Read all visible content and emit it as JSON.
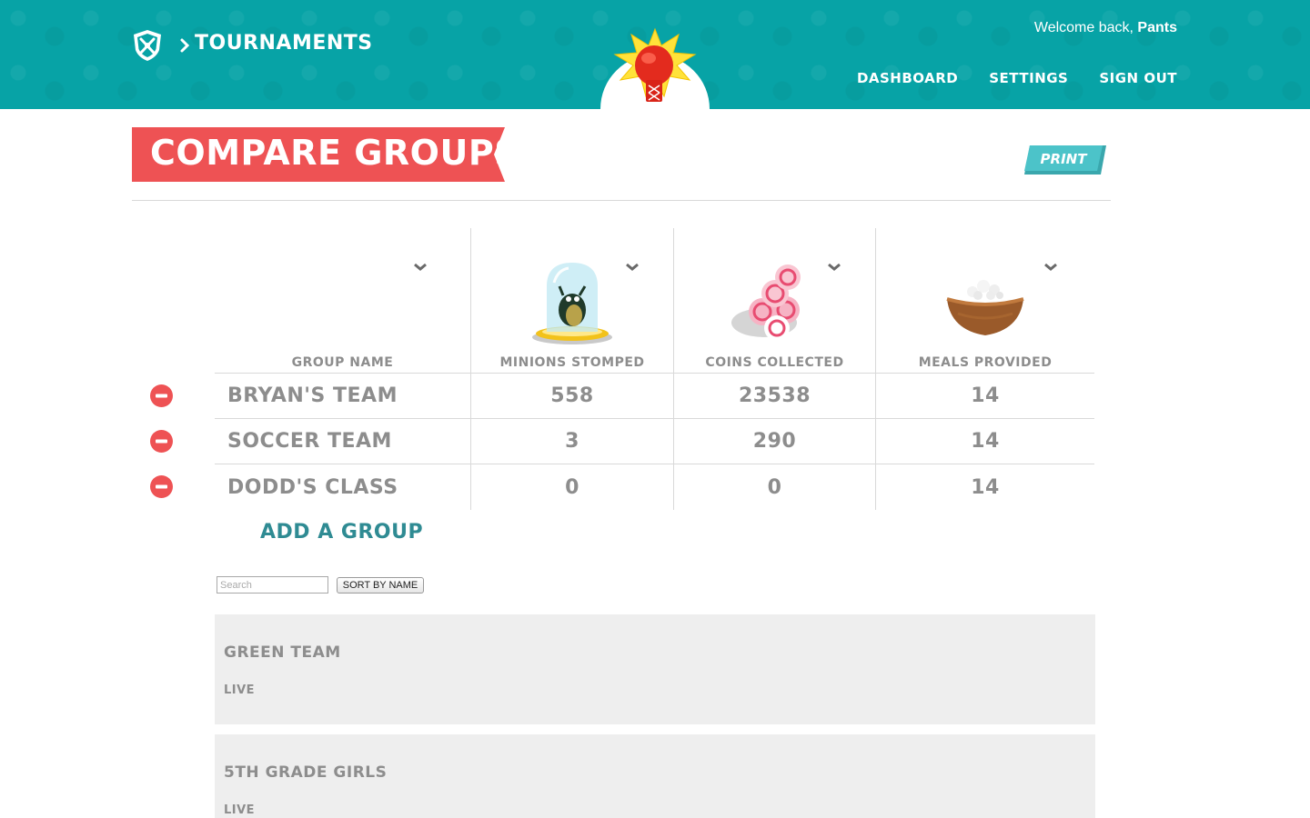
{
  "header": {
    "breadcrumb": "TOURNAMENTS",
    "welcome_prefix": "Welcome back,",
    "user_name": "Pants",
    "nav": [
      "DASHBOARD",
      "SETTINGS",
      "SIGN OUT"
    ]
  },
  "page": {
    "title": "COMPARE GROUPS",
    "print_label": "PRINT"
  },
  "compare": {
    "columns": [
      "GROUP NAME",
      "MINIONS STOMPED",
      "COINS COLLECTED",
      "MEALS PROVIDED"
    ],
    "column_icons": [
      "",
      "minion-in-glass-dome-icon",
      "pink-coins-stack-icon",
      "rice-bowl-icon"
    ],
    "rows": [
      {
        "name": "BRYAN'S TEAM",
        "minions": "558",
        "coins": "23538",
        "meals": "14"
      },
      {
        "name": "SOCCER TEAM",
        "minions": "3",
        "coins": "290",
        "meals": "14"
      },
      {
        "name": "DODD'S CLASS",
        "minions": "0",
        "coins": "0",
        "meals": "14"
      }
    ],
    "add_group_label": "ADD A GROUP"
  },
  "search": {
    "placeholder": "Search",
    "sort_label": "SORT BY NAME"
  },
  "groups": [
    {
      "name": "GREEN TEAM",
      "status": "LIVE"
    },
    {
      "name": "5TH GRADE GIRLS",
      "status": "LIVE"
    }
  ],
  "colors": {
    "header_teal": "#07a3a6",
    "title_red": "#ee5254",
    "print_teal": "#4cc3c9",
    "add_group_teal": "#2f8b93",
    "text_gray": "#8d8d8d",
    "card_gray": "#eeeeee"
  }
}
